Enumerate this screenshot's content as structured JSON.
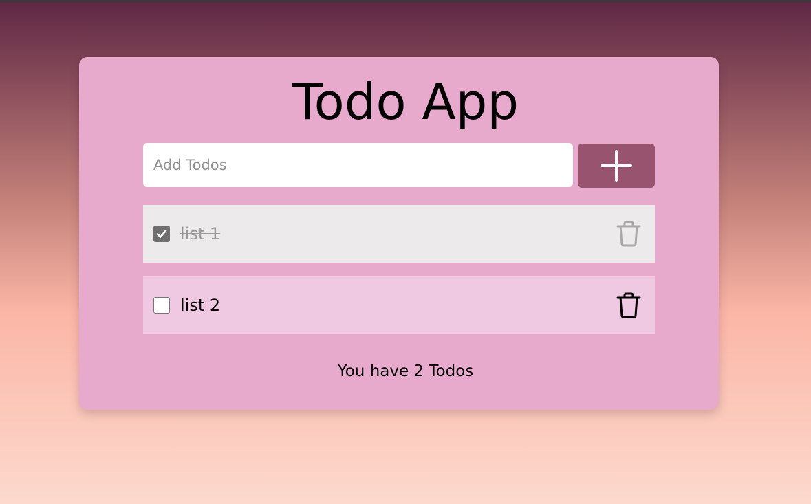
{
  "app": {
    "title": "Todo App"
  },
  "input": {
    "placeholder": "Add Todos",
    "value": ""
  },
  "add_button": {
    "icon": "plus-icon"
  },
  "todos": [
    {
      "label": "list 1",
      "completed": true,
      "delete_icon": "trash-icon"
    },
    {
      "label": "list 2",
      "completed": false,
      "delete_icon": "trash-icon"
    }
  ],
  "footer": {
    "count_text": "You have 2 Todos"
  },
  "colors": {
    "card_background": "#e7a9cc",
    "accent": "#98546f",
    "completed_row": "#edeaeb",
    "open_row": "#efc9e2"
  }
}
